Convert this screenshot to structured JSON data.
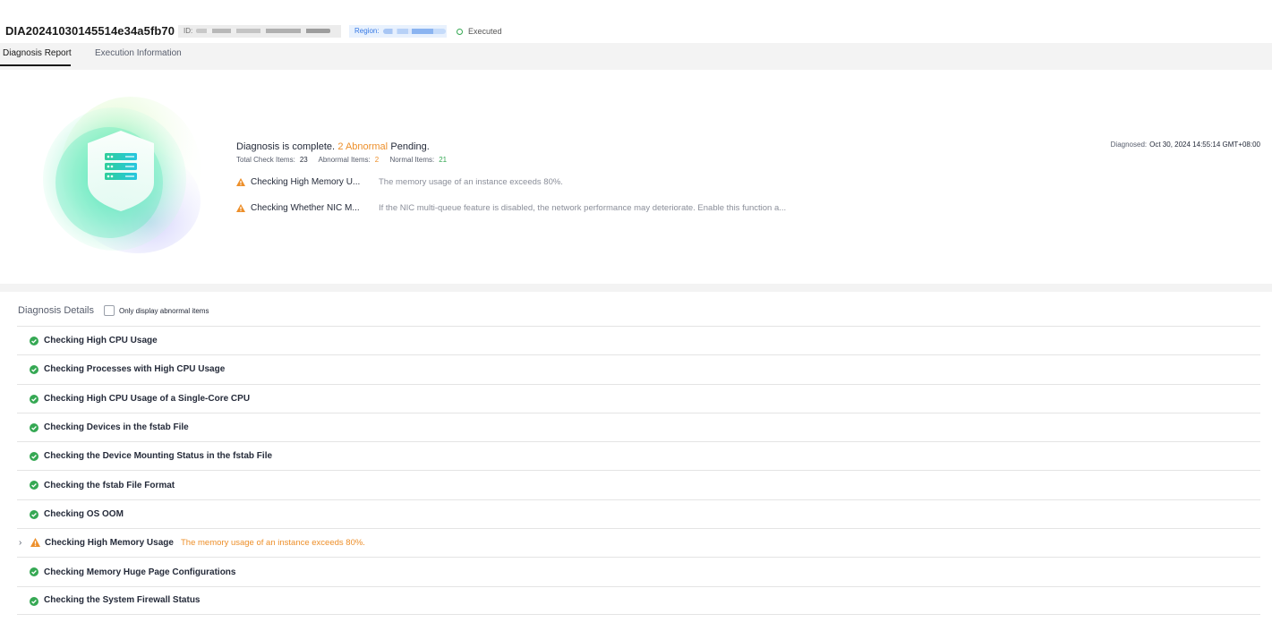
{
  "header": {
    "title": "DIA20241030145514e34a5fb70",
    "id_label": "ID:",
    "region_label": "Region:",
    "status": "Executed"
  },
  "tabs": [
    {
      "label": "Diagnosis Report",
      "active": true
    },
    {
      "label": "Execution Information",
      "active": false
    }
  ],
  "summary": {
    "headline_prefix": "Diagnosis is complete.",
    "headline_abnormal": "2 Abnormal",
    "headline_suffix": "Pending.",
    "total_label": "Total Check Items:",
    "total_value": "23",
    "abnormal_label": "Abnormal Items:",
    "abnormal_value": "2",
    "normal_label": "Normal Items:",
    "normal_value": "21",
    "issues": [
      {
        "name": "Checking High Memory U...",
        "desc": "The memory usage of an instance exceeds 80%."
      },
      {
        "name": "Checking Whether NIC M...",
        "desc": "If the NIC multi-queue feature is disabled, the network performance may deteriorate. Enable this function a..."
      }
    ],
    "diagnosed_label": "Diagnosed:",
    "diagnosed_value": "Oct 30, 2024 14:55:14 GMT+08:00"
  },
  "details": {
    "heading": "Diagnosis Details",
    "filter_label": "Only display abnormal items",
    "rows": [
      {
        "label": "Checking High CPU Usage",
        "status": "normal"
      },
      {
        "label": "Checking Processes with High CPU Usage",
        "status": "normal"
      },
      {
        "label": "Checking High CPU Usage of a Single-Core CPU",
        "status": "normal"
      },
      {
        "label": "Checking Devices in the fstab File",
        "status": "normal"
      },
      {
        "label": "Checking the Device Mounting Status in the fstab File",
        "status": "normal"
      },
      {
        "label": "Checking the fstab File Format",
        "status": "normal"
      },
      {
        "label": "Checking OS OOM",
        "status": "normal"
      },
      {
        "label": "Checking High Memory Usage",
        "status": "abnormal",
        "desc": "The memory usage of an instance exceeds 80%."
      },
      {
        "label": "Checking Memory Huge Page Configurations",
        "status": "normal"
      },
      {
        "label": "Checking the System Firewall Status",
        "status": "normal"
      }
    ]
  },
  "colors": {
    "accent_orange": "#ed8f2a",
    "ok_green": "#35a853",
    "region_blue": "#3578e5"
  },
  "icons": {
    "ok": "check-circle-icon",
    "warn": "warning-triangle-icon",
    "expand": "chevron-right-icon",
    "status": "status-ring-icon",
    "illustration": "shield-server-icon"
  }
}
